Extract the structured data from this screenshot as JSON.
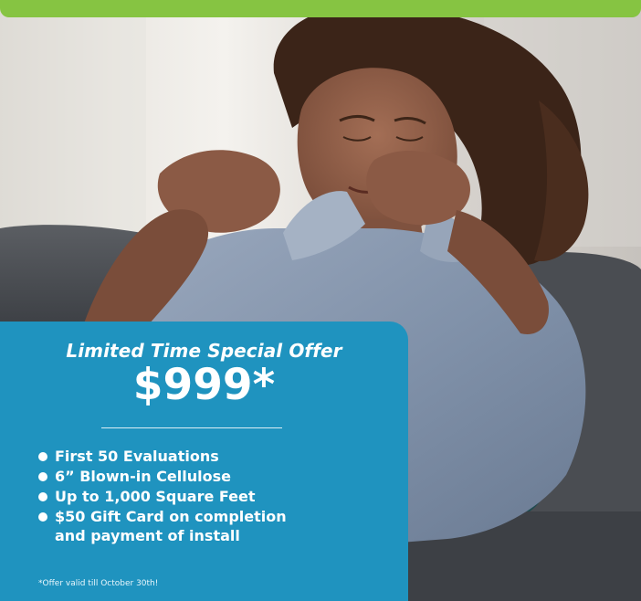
{
  "banner": {
    "color": "#86c442"
  },
  "hero": {
    "image_subject": "woman-fanning-herself-icon"
  },
  "offer": {
    "title": "Limited Time Special Offer",
    "price": "$999*",
    "bullets": [
      "First 50 Evaluations",
      "6” Blown-in Cellulose",
      "Up to 1,000 Square Feet",
      "$50 Gift Card on completion and payment of install"
    ],
    "footnote": "*Offer valid till October 30th!",
    "background_color": "#1f93bf"
  }
}
